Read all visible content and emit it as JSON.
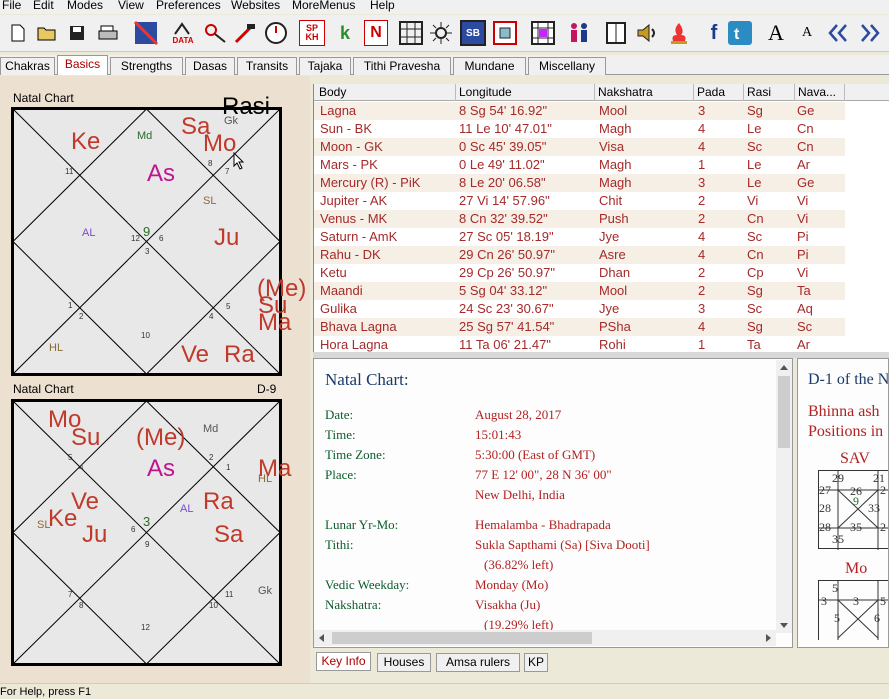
{
  "menu": [
    "File",
    "Edit",
    "Modes",
    "View",
    "Preferences",
    "Websites",
    "MoreMenus",
    "Help"
  ],
  "toolbar": {
    "sp_kh": "SP\nKH",
    "data": "DATA",
    "k": "k",
    "n": "N",
    "sb": "SB",
    "font_big": "A",
    "font_small": "A"
  },
  "tabs": [
    "Chakras",
    "Basics",
    "Strengths",
    "Dasas",
    "Transits",
    "Tajaka",
    "Tithi Pravesha",
    "Mundane",
    "Miscellany"
  ],
  "active_tab": "Basics",
  "rasi_chart": {
    "label": "Natal Chart",
    "overlay": "Rasi",
    "planets": [
      "Ke",
      "Sa",
      "Mo",
      "As",
      "Ju",
      "(Me)",
      "Su",
      "Ma",
      "Ve",
      "Ra"
    ],
    "small": [
      "Md",
      "Gk",
      "SL",
      "AL",
      "HL"
    ],
    "house_numbers": [
      "11",
      "8",
      "7",
      "12",
      "9",
      "6",
      "3",
      "1",
      "2",
      "5",
      "4",
      "10"
    ]
  },
  "navamsa_chart": {
    "label": "Natal Chart",
    "division": "D-9",
    "planets": [
      "Mo",
      "Su",
      "(Me)",
      "As",
      "Ma",
      "Ve",
      "Ke",
      "Ju",
      "Ra",
      "Sa"
    ],
    "small": [
      "Md",
      "HL",
      "SL",
      "AL",
      "Gk"
    ],
    "house_numbers": [
      "5",
      "4",
      "2",
      "1",
      "3",
      "6",
      "9",
      "7",
      "8",
      "10",
      "11",
      "12"
    ]
  },
  "table": {
    "headers": [
      "Body",
      "Longitude",
      "Nakshatra",
      "Pada",
      "Rasi",
      "Nava..."
    ],
    "rows": [
      [
        "Lagna",
        "8 Sg 54' 16.92\"",
        "Mool",
        "3",
        "Sg",
        "Ge"
      ],
      [
        "Sun - BK",
        "11 Le 10' 47.01\"",
        "Magh",
        "4",
        "Le",
        "Cn"
      ],
      [
        "Moon - GK",
        "0 Sc 45' 39.05\"",
        "Visa",
        "4",
        "Sc",
        "Cn"
      ],
      [
        "Mars - PK",
        "0 Le 49' 11.02\"",
        "Magh",
        "1",
        "Le",
        "Ar"
      ],
      [
        "Mercury (R) - PiK",
        "8 Le 20' 06.58\"",
        "Magh",
        "3",
        "Le",
        "Ge"
      ],
      [
        "Jupiter - AK",
        "27 Vi 14' 57.96\"",
        "Chit",
        "2",
        "Vi",
        "Vi"
      ],
      [
        "Venus - MK",
        "8 Cn 32' 39.52\"",
        "Push",
        "2",
        "Cn",
        "Vi"
      ],
      [
        "Saturn - AmK",
        "27 Sc 05' 18.19\"",
        "Jye",
        "4",
        "Sc",
        "Pi"
      ],
      [
        "Rahu - DK",
        "29 Cn 26' 50.97\"",
        "Asre",
        "4",
        "Cn",
        "Pi"
      ],
      [
        "Ketu",
        "29 Cp 26' 50.97\"",
        "Dhan",
        "2",
        "Cp",
        "Vi"
      ],
      [
        "Maandi",
        "5 Sg 04' 33.12\"",
        "Mool",
        "2",
        "Sg",
        "Ta"
      ],
      [
        "Gulika",
        "24 Sc 23' 30.67\"",
        "Jye",
        "3",
        "Sc",
        "Aq"
      ],
      [
        "Bhava Lagna",
        "25 Sg 57' 41.54\"",
        "PSha",
        "4",
        "Sg",
        "Sc"
      ],
      [
        "Hora Lagna",
        "11 Ta 06' 21.47\"",
        "Rohi",
        "1",
        "Ta",
        "Ar"
      ]
    ]
  },
  "info": {
    "title": "Natal Chart:",
    "rows": [
      {
        "key": "Date:",
        "value": "August 28, 2017"
      },
      {
        "key": "Time:",
        "value": "15:01:43"
      },
      {
        "key": "Time Zone:",
        "value": "5:30:00 (East of GMT)"
      },
      {
        "key": "Place:",
        "value": "77 E 12' 00\", 28 N 36' 00\""
      },
      {
        "key": "",
        "value": "New Delhi, India"
      },
      {
        "key": "Lunar Yr-Mo:",
        "value": "Hemalamba - Bhadrapada"
      },
      {
        "key": "Tithi:",
        "value": "Sukla Sapthami (Sa) [Siva Dooti]"
      },
      {
        "key": "",
        "value": "(36.82% left)"
      },
      {
        "key": "Vedic Weekday:",
        "value": "Monday (Mo)"
      },
      {
        "key": "Nakshatra:",
        "value": "Visakha (Ju)"
      },
      {
        "key": "",
        "value": "(19.29% left)"
      }
    ]
  },
  "right_panel": {
    "title": "D-1 of the N",
    "line1": "Bhinna ash",
    "line2": "Positions in",
    "sav_label": "SAV",
    "sav_values": [
      "29",
      "21",
      "27",
      "26",
      "2",
      "9",
      "28",
      "33",
      "28",
      "35",
      "2",
      "35"
    ],
    "mo_label": "Mo",
    "mo_values": [
      "5",
      "3",
      "3",
      "5",
      "5",
      "6"
    ]
  },
  "bottom_tabs": [
    "Key Info",
    "Houses",
    "Amsa rulers",
    "KP"
  ],
  "active_bottom_tab": "Key Info",
  "status": "For Help, press F1"
}
